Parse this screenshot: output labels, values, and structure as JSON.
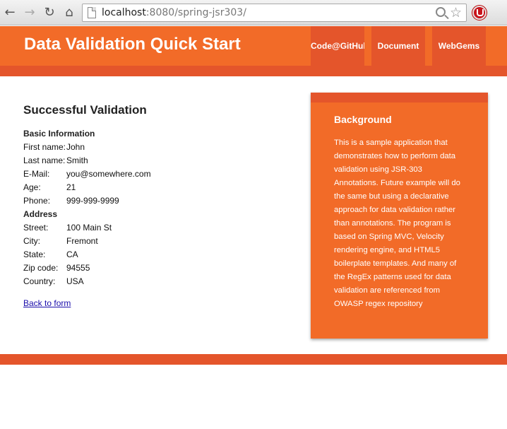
{
  "browser": {
    "url_host": "localhost",
    "url_rest": ":8080/spring-jsr303/",
    "back_icon": "back-arrow-icon",
    "forward_icon": "forward-arrow-icon",
    "reload_icon": "reload-icon",
    "home_icon": "home-icon"
  },
  "header": {
    "title": "Data Validation Quick Start",
    "nav": [
      "Code@GitHub",
      "Document",
      "WebGems"
    ]
  },
  "main": {
    "heading": "Successful Validation",
    "basic_heading": "Basic Information",
    "basic": [
      {
        "label": "First name:",
        "value": "John"
      },
      {
        "label": "Last name:",
        "value": "Smith"
      },
      {
        "label": "E-Mail:",
        "value": "you@somewhere.com"
      },
      {
        "label": "Age:",
        "value": "21"
      },
      {
        "label": "Phone:",
        "value": "999-999-9999"
      }
    ],
    "address_heading": "Address",
    "address": [
      {
        "label": "Street:",
        "value": "100 Main St"
      },
      {
        "label": "City:",
        "value": "Fremont"
      },
      {
        "label": "State:",
        "value": "CA"
      },
      {
        "label": "Zip code:",
        "value": "94555"
      },
      {
        "label": "Country:",
        "value": "USA"
      }
    ],
    "back_link": "Back to form"
  },
  "aside": {
    "title": "Background",
    "text": "This is a sample application that demonstrates how to perform data validation using JSR-303 Annotations. Future example will do the same but using a declarative approach for data validation rather than annotations. The program is based on Spring MVC, Velocity rendering engine, and HTML5 boilerplate templates. And many of the RegEx patterns used for data validation are referenced from OWASP regex repository"
  },
  "colors": {
    "header": "#f26b28",
    "header_dark": "#e4552b",
    "link": "#1a0dab"
  }
}
